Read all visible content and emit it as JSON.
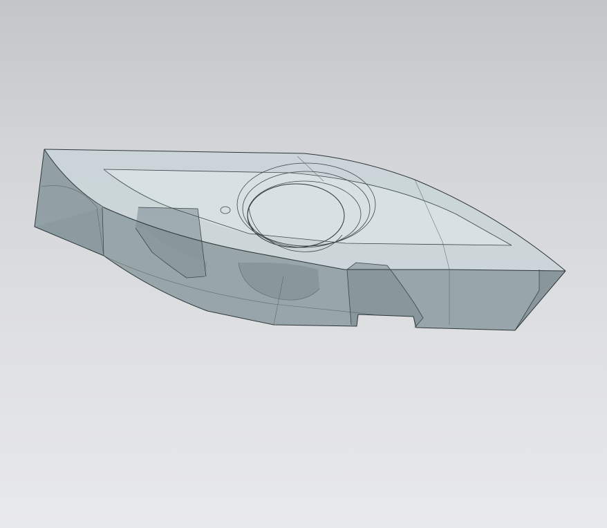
{
  "viewport": {
    "background_top": "#c3c5c8",
    "background_bottom": "#e8e9eb",
    "model_color": "#8e9ea3"
  }
}
